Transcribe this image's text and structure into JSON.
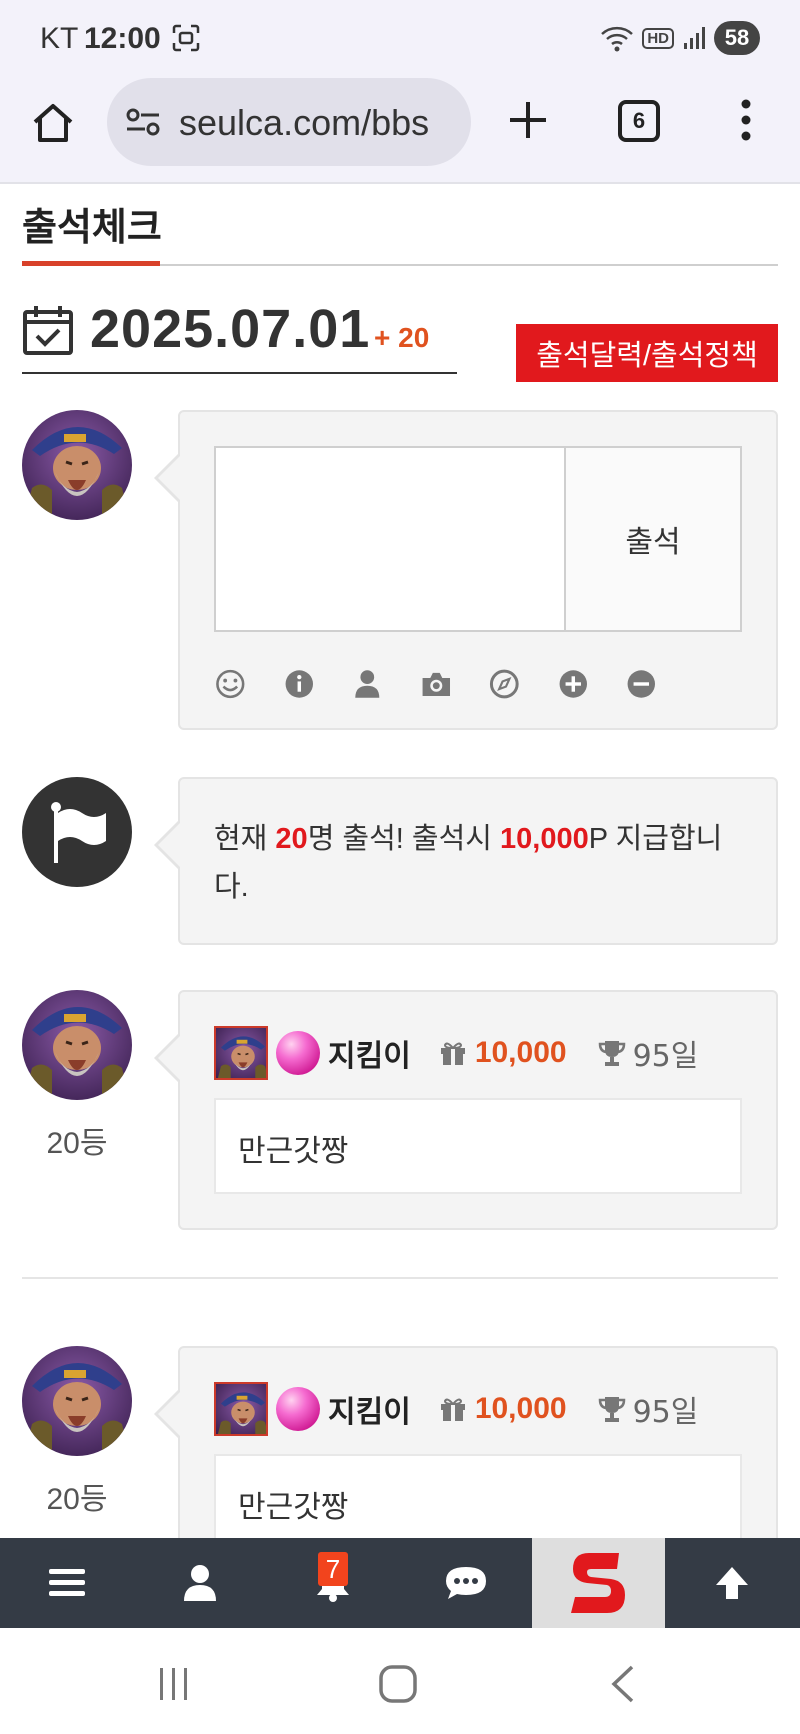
{
  "status_bar": {
    "carrier": "KT",
    "time": "12:00",
    "battery": "58",
    "network": "HD"
  },
  "browser": {
    "url": "seulca.com/bbs",
    "tab_count": "6"
  },
  "page": {
    "title": "출석체크",
    "date": "2025.07.01",
    "attend_count": "+ 20",
    "policy_button": "출석달력/출석정책"
  },
  "form": {
    "submit_label": "출석",
    "textarea_value": "",
    "tools": [
      "smile-icon",
      "info-icon",
      "user-icon",
      "camera-icon",
      "compass-icon",
      "plus-circle-icon",
      "minus-circle-icon"
    ]
  },
  "notice": {
    "prefix": "현재 ",
    "count": "20",
    "middle": "명 출석! 출석시 ",
    "points": "10,000",
    "suffix": "P 지급합니다."
  },
  "entries": [
    {
      "rank": "20등",
      "name": "지킴이",
      "points": "10,000",
      "days": "95일",
      "message": "만근갓짱"
    },
    {
      "rank": "20등",
      "name": "지킴이",
      "points": "10,000",
      "days": "95일",
      "message": "만근갓짱"
    }
  ],
  "bottom_nav": {
    "notification_badge": "7",
    "items": [
      "menu-icon",
      "user-icon",
      "bell-icon",
      "chat-icon",
      "site-logo",
      "arrow-up-icon"
    ]
  },
  "colors": {
    "accent_red": "#e1191d",
    "accent_orange": "#e0521f",
    "nav_bg": "#343b45"
  }
}
